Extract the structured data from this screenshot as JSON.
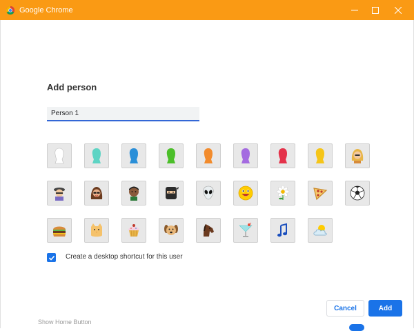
{
  "window": {
    "title": "Google Chrome",
    "accent_color": "#fa9a14",
    "icon": "chrome-icon",
    "controls": [
      "minimize-icon",
      "maximize-icon",
      "close-icon"
    ]
  },
  "dialog": {
    "heading": "Add person",
    "name_input_value": "Person 1",
    "avatars": [
      {
        "name": "white-silhouette"
      },
      {
        "name": "teal-silhouette"
      },
      {
        "name": "blue-silhouette"
      },
      {
        "name": "green-silhouette"
      },
      {
        "name": "orange-silhouette"
      },
      {
        "name": "purple-silhouette"
      },
      {
        "name": "red-silhouette"
      },
      {
        "name": "yellow-silhouette"
      },
      {
        "name": "blonde-woman"
      },
      {
        "name": "ninja-boy"
      },
      {
        "name": "woman-sunglasses"
      },
      {
        "name": "man-face"
      },
      {
        "name": "ninja"
      },
      {
        "name": "alien"
      },
      {
        "name": "smiley"
      },
      {
        "name": "flower"
      },
      {
        "name": "pizza"
      },
      {
        "name": "soccer-ball"
      },
      {
        "name": "burger"
      },
      {
        "name": "cat"
      },
      {
        "name": "cupcake"
      },
      {
        "name": "dog"
      },
      {
        "name": "horse"
      },
      {
        "name": "cocktail"
      },
      {
        "name": "music-note"
      },
      {
        "name": "sun-cloud"
      }
    ],
    "checkbox_label": "Create a desktop shortcut for this user",
    "checkbox_checked": true,
    "cancel_label": "Cancel",
    "add_label": "Add"
  },
  "background": {
    "partial_text": "Show Home Button"
  }
}
